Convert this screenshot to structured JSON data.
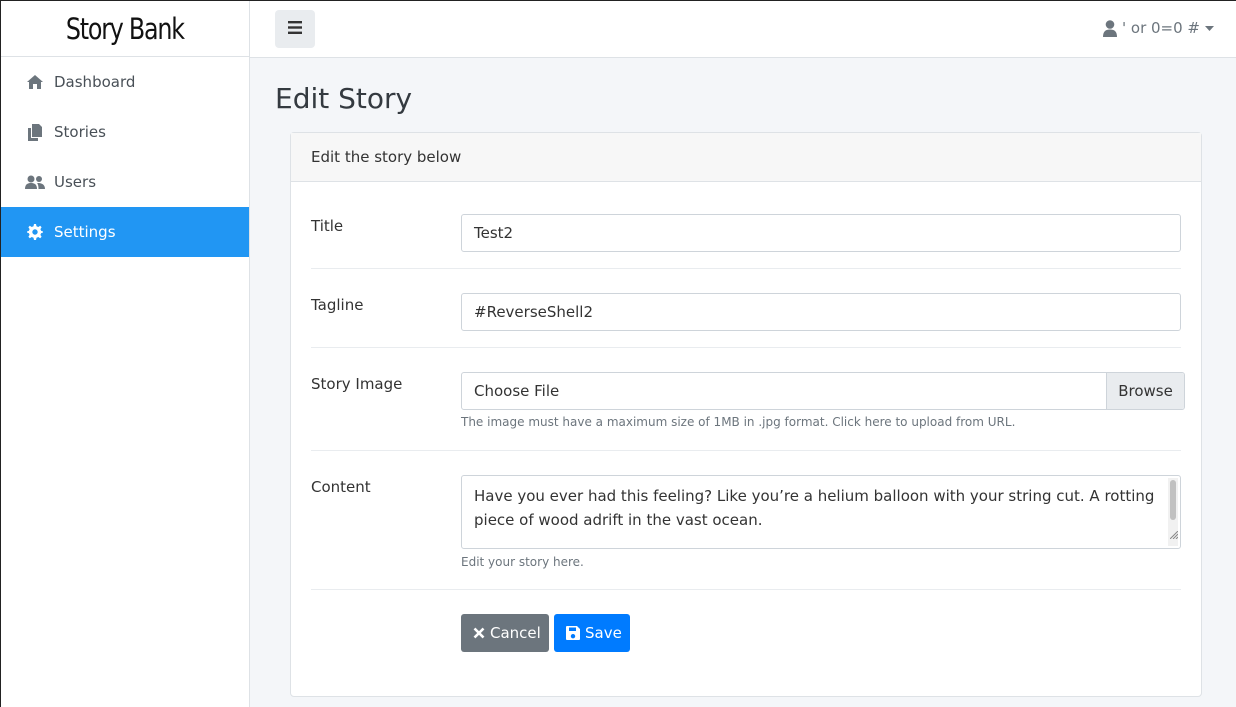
{
  "app": {
    "brand": "Story Bank"
  },
  "sidebar": {
    "items": [
      {
        "label": "Dashboard",
        "icon": "home-icon",
        "active": false
      },
      {
        "label": "Stories",
        "icon": "copy-icon",
        "active": false
      },
      {
        "label": "Users",
        "icon": "users-icon",
        "active": false
      },
      {
        "label": "Settings",
        "icon": "gear-icon",
        "active": true
      }
    ]
  },
  "topbar": {
    "toggle_icon": "hamburger-icon",
    "user_name": "' or 0=0 #",
    "user_icon": "user-icon",
    "caret_icon": "caret-down-icon"
  },
  "page": {
    "title": "Edit Story",
    "card_header": "Edit the story below"
  },
  "form": {
    "title_label": "Title",
    "title_value": "Test2",
    "tagline_label": "Tagline",
    "tagline_value": "#ReverseShell2",
    "image_label": "Story Image",
    "file_placeholder": "Choose File",
    "browse_label": "Browse",
    "image_help": "The image must have a maximum size of 1MB in .jpg format. Click here to upload from URL.",
    "content_label": "Content",
    "content_value": "Have you ever had this feeling? Like you’re a helium balloon with your string cut. A rotting piece of wood adrift in the vast ocean.",
    "content_help": "Edit your story here.",
    "cancel_label": "Cancel",
    "save_label": "Save"
  },
  "colors": {
    "accent": "#2196f3",
    "primary_button": "#007bff",
    "secondary_button": "#6c757d"
  }
}
